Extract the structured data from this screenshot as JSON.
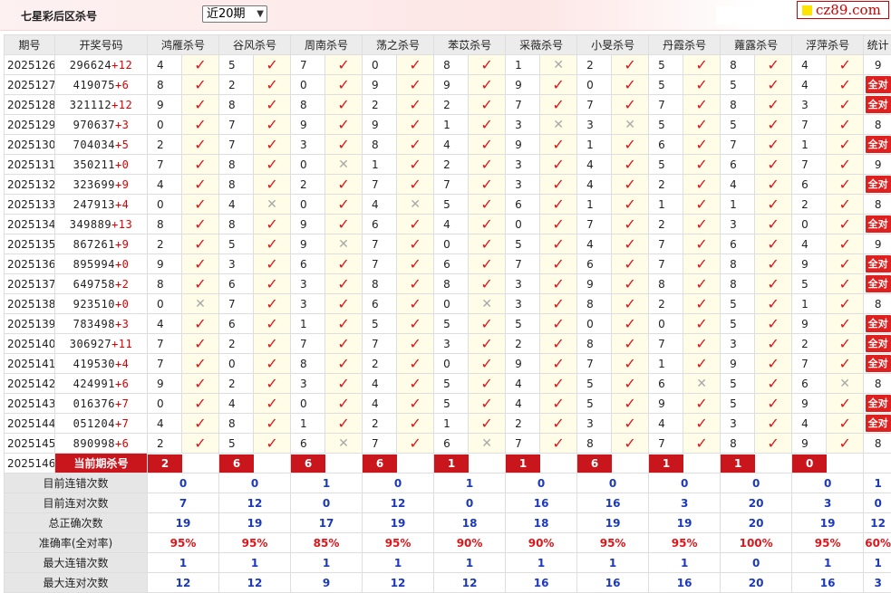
{
  "header": {
    "title": "七星彩后区杀号",
    "period_select": "近20期",
    "logo": "cz89.com"
  },
  "columns": {
    "period": "期号",
    "number": "开奖号码",
    "stat": "统计",
    "experts": [
      "鸿雁杀号",
      "谷风杀号",
      "周南杀号",
      "荡之杀号",
      "苯苡杀号",
      "采薇杀号",
      "小旻杀号",
      "丹霞杀号",
      "蕹露杀号",
      "浮萍杀号"
    ]
  },
  "rows": [
    {
      "period": "2025126",
      "digits": "296624",
      "bonus": "+12",
      "picks": [
        "4",
        "5",
        "7",
        "0",
        "8",
        "1",
        "2",
        "5",
        "8",
        "4"
      ],
      "ok": [
        1,
        1,
        1,
        1,
        1,
        0,
        1,
        1,
        1,
        1
      ],
      "stat": "9"
    },
    {
      "period": "2025127",
      "digits": "419075",
      "bonus": "+6",
      "picks": [
        "8",
        "2",
        "0",
        "9",
        "9",
        "9",
        "0",
        "5",
        "5",
        "4"
      ],
      "ok": [
        1,
        1,
        1,
        1,
        1,
        1,
        1,
        1,
        1,
        1
      ],
      "stat": "全对"
    },
    {
      "period": "2025128",
      "digits": "321112",
      "bonus": "+12",
      "picks": [
        "9",
        "8",
        "8",
        "2",
        "2",
        "7",
        "7",
        "7",
        "8",
        "3"
      ],
      "ok": [
        1,
        1,
        1,
        1,
        1,
        1,
        1,
        1,
        1,
        1
      ],
      "stat": "全对"
    },
    {
      "period": "2025129",
      "digits": "970637",
      "bonus": "+3",
      "picks": [
        "0",
        "7",
        "9",
        "9",
        "1",
        "3",
        "3",
        "5",
        "5",
        "7"
      ],
      "ok": [
        1,
        1,
        1,
        1,
        1,
        0,
        0,
        1,
        1,
        1
      ],
      "stat": "8"
    },
    {
      "period": "2025130",
      "digits": "704034",
      "bonus": "+5",
      "picks": [
        "2",
        "7",
        "3",
        "8",
        "4",
        "9",
        "1",
        "6",
        "7",
        "1"
      ],
      "ok": [
        1,
        1,
        1,
        1,
        1,
        1,
        1,
        1,
        1,
        1
      ],
      "stat": "全对"
    },
    {
      "period": "2025131",
      "digits": "350211",
      "bonus": "+0",
      "picks": [
        "7",
        "8",
        "0",
        "1",
        "2",
        "3",
        "4",
        "5",
        "6",
        "7"
      ],
      "ok": [
        1,
        1,
        0,
        1,
        1,
        1,
        1,
        1,
        1,
        1
      ],
      "stat": "9"
    },
    {
      "period": "2025132",
      "digits": "323699",
      "bonus": "+9",
      "picks": [
        "4",
        "8",
        "2",
        "7",
        "7",
        "3",
        "4",
        "2",
        "4",
        "6"
      ],
      "ok": [
        1,
        1,
        1,
        1,
        1,
        1,
        1,
        1,
        1,
        1
      ],
      "stat": "全对"
    },
    {
      "period": "2025133",
      "digits": "247913",
      "bonus": "+4",
      "picks": [
        "0",
        "4",
        "0",
        "4",
        "5",
        "6",
        "1",
        "1",
        "1",
        "2"
      ],
      "ok": [
        1,
        0,
        1,
        0,
        1,
        1,
        1,
        1,
        1,
        1
      ],
      "stat": "8"
    },
    {
      "period": "2025134",
      "digits": "349889",
      "bonus": "+13",
      "picks": [
        "8",
        "8",
        "9",
        "6",
        "4",
        "0",
        "7",
        "2",
        "3",
        "0"
      ],
      "ok": [
        1,
        1,
        1,
        1,
        1,
        1,
        1,
        1,
        1,
        1
      ],
      "stat": "全对"
    },
    {
      "period": "2025135",
      "digits": "867261",
      "bonus": "+9",
      "picks": [
        "2",
        "5",
        "9",
        "7",
        "0",
        "5",
        "4",
        "7",
        "6",
        "4"
      ],
      "ok": [
        1,
        1,
        0,
        1,
        1,
        1,
        1,
        1,
        1,
        1
      ],
      "stat": "9"
    },
    {
      "period": "2025136",
      "digits": "895994",
      "bonus": "+0",
      "picks": [
        "9",
        "3",
        "6",
        "7",
        "6",
        "7",
        "6",
        "7",
        "8",
        "9"
      ],
      "ok": [
        1,
        1,
        1,
        1,
        1,
        1,
        1,
        1,
        1,
        1
      ],
      "stat": "全对"
    },
    {
      "period": "2025137",
      "digits": "649758",
      "bonus": "+2",
      "picks": [
        "8",
        "6",
        "3",
        "8",
        "8",
        "3",
        "9",
        "8",
        "8",
        "5"
      ],
      "ok": [
        1,
        1,
        1,
        1,
        1,
        1,
        1,
        1,
        1,
        1
      ],
      "stat": "全对"
    },
    {
      "period": "2025138",
      "digits": "923510",
      "bonus": "+0",
      "picks": [
        "0",
        "7",
        "3",
        "6",
        "0",
        "3",
        "8",
        "2",
        "5",
        "1"
      ],
      "ok": [
        0,
        1,
        1,
        1,
        0,
        1,
        1,
        1,
        1,
        1
      ],
      "stat": "8"
    },
    {
      "period": "2025139",
      "digits": "783498",
      "bonus": "+3",
      "picks": [
        "4",
        "6",
        "1",
        "5",
        "5",
        "5",
        "0",
        "0",
        "5",
        "9"
      ],
      "ok": [
        1,
        1,
        1,
        1,
        1,
        1,
        1,
        1,
        1,
        1
      ],
      "stat": "全对"
    },
    {
      "period": "2025140",
      "digits": "306927",
      "bonus": "+11",
      "picks": [
        "7",
        "2",
        "7",
        "7",
        "3",
        "2",
        "8",
        "7",
        "3",
        "2"
      ],
      "ok": [
        1,
        1,
        1,
        1,
        1,
        1,
        1,
        1,
        1,
        1
      ],
      "stat": "全对"
    },
    {
      "period": "2025141",
      "digits": "419530",
      "bonus": "+4",
      "picks": [
        "7",
        "0",
        "8",
        "2",
        "0",
        "9",
        "7",
        "1",
        "9",
        "7"
      ],
      "ok": [
        1,
        1,
        1,
        1,
        1,
        1,
        1,
        1,
        1,
        1
      ],
      "stat": "全对"
    },
    {
      "period": "2025142",
      "digits": "424991",
      "bonus": "+6",
      "picks": [
        "9",
        "2",
        "3",
        "4",
        "5",
        "4",
        "5",
        "6",
        "5",
        "6"
      ],
      "ok": [
        1,
        1,
        1,
        1,
        1,
        1,
        1,
        0,
        1,
        0
      ],
      "stat": "8"
    },
    {
      "period": "2025143",
      "digits": "016376",
      "bonus": "+7",
      "picks": [
        "0",
        "4",
        "0",
        "4",
        "5",
        "4",
        "5",
        "9",
        "5",
        "9"
      ],
      "ok": [
        1,
        1,
        1,
        1,
        1,
        1,
        1,
        1,
        1,
        1
      ],
      "stat": "全对"
    },
    {
      "period": "2025144",
      "digits": "051204",
      "bonus": "+7",
      "picks": [
        "4",
        "8",
        "1",
        "2",
        "1",
        "2",
        "3",
        "4",
        "3",
        "4"
      ],
      "ok": [
        1,
        1,
        1,
        1,
        1,
        1,
        1,
        1,
        1,
        1
      ],
      "stat": "全对"
    },
    {
      "period": "2025145",
      "digits": "890998",
      "bonus": "+6",
      "picks": [
        "2",
        "5",
        "6",
        "7",
        "6",
        "7",
        "8",
        "7",
        "8",
        "9"
      ],
      "ok": [
        1,
        1,
        0,
        1,
        0,
        1,
        1,
        1,
        1,
        1
      ],
      "stat": "8"
    }
  ],
  "current": {
    "period": "2025146",
    "label": "当前期杀号",
    "picks": [
      "2",
      "6",
      "6",
      "6",
      "1",
      "1",
      "6",
      "1",
      "1",
      "0"
    ]
  },
  "stats": [
    {
      "label": "目前连错次数",
      "values": [
        "0",
        "0",
        "1",
        "0",
        "1",
        "0",
        "0",
        "0",
        "0",
        "0"
      ],
      "total": "1",
      "red": false
    },
    {
      "label": "目前连对次数",
      "values": [
        "7",
        "12",
        "0",
        "12",
        "0",
        "16",
        "16",
        "3",
        "20",
        "3"
      ],
      "total": "0",
      "red": false
    },
    {
      "label": "总正确次数",
      "values": [
        "19",
        "19",
        "17",
        "19",
        "18",
        "18",
        "19",
        "19",
        "20",
        "19"
      ],
      "total": "12",
      "red": false
    },
    {
      "label": "准确率(全对率)",
      "values": [
        "95%",
        "95%",
        "85%",
        "95%",
        "90%",
        "90%",
        "95%",
        "95%",
        "100%",
        "95%"
      ],
      "total": "60%",
      "red": true
    },
    {
      "label": "最大连错次数",
      "values": [
        "1",
        "1",
        "1",
        "1",
        "1",
        "1",
        "1",
        "1",
        "0",
        "1"
      ],
      "total": "1",
      "red": false
    },
    {
      "label": "最大连对次数",
      "values": [
        "12",
        "12",
        "9",
        "12",
        "12",
        "16",
        "16",
        "16",
        "20",
        "16"
      ],
      "total": "3",
      "red": false
    }
  ],
  "icons": {
    "correct": "check-mark",
    "wrong": "cross-mark"
  },
  "colors": {
    "accent": "#e0151a",
    "badge": "#e0201f",
    "current_row": "#c9161d",
    "stat_blue": "#1c39bb",
    "mark_bg": "#fffde8"
  }
}
